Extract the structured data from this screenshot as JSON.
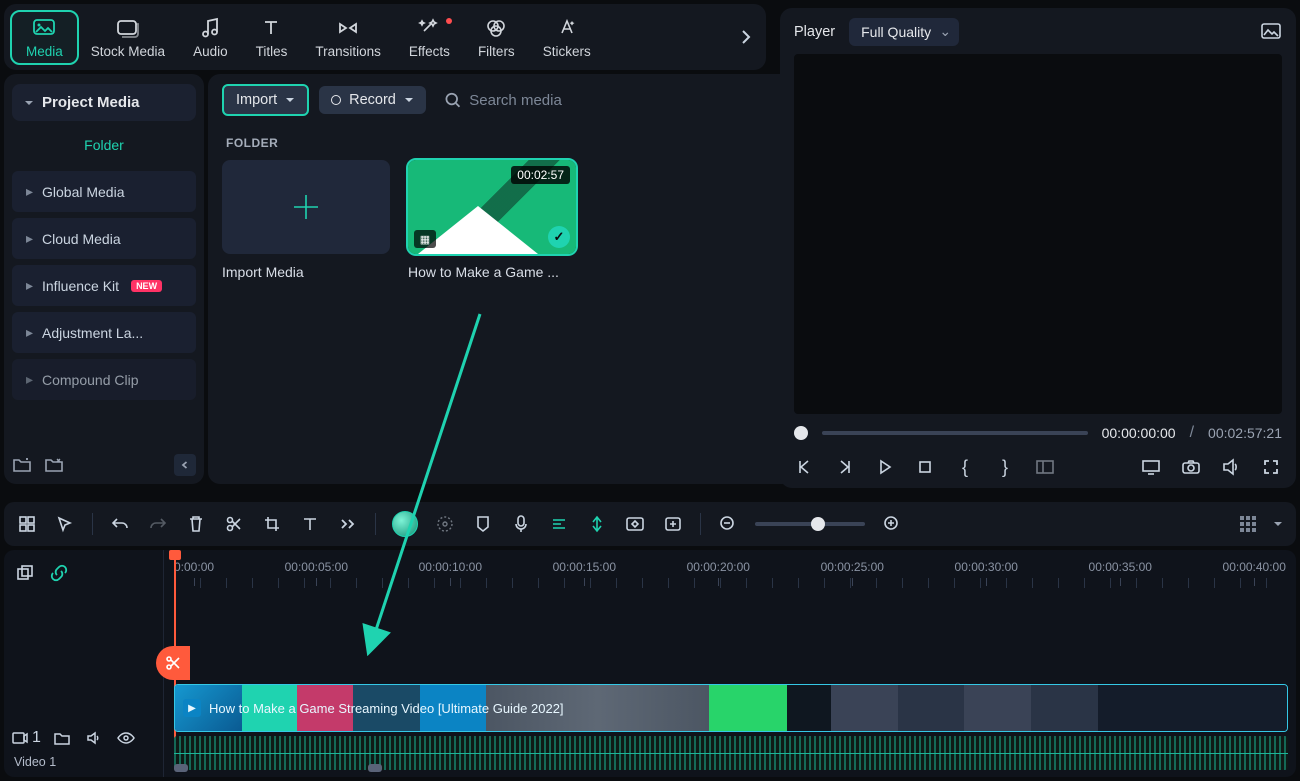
{
  "tabs": {
    "media": "Media",
    "stock": "Stock Media",
    "audio": "Audio",
    "titles": "Titles",
    "transitions": "Transitions",
    "effects": "Effects",
    "filters": "Filters",
    "stickers": "Stickers"
  },
  "sidebar": {
    "header": "Project Media",
    "folder_heading": "Folder",
    "global": "Global Media",
    "cloud": "Cloud Media",
    "influence": "Influence Kit",
    "adjustment": "Adjustment La...",
    "compound": "Compound Clip",
    "new_badge": "NEW"
  },
  "toolbar": {
    "import": "Import",
    "record": "Record",
    "search_placeholder": "Search media"
  },
  "folder_heading": "FOLDER",
  "import_card": "Import Media",
  "media_clip": {
    "label": "How to Make a Game ...",
    "duration": "00:02:57"
  },
  "player": {
    "label": "Player",
    "quality": "Full Quality",
    "time_current": "00:00:00:00",
    "time_total": "00:02:57:21",
    "separator": "/"
  },
  "ruler": {
    "t0": "0:00:00",
    "t1": "00:00:05:00",
    "t2": "00:00:10:00",
    "t3": "00:00:15:00",
    "t4": "00:00:20:00",
    "t5": "00:00:25:00",
    "t6": "00:00:30:00",
    "t7": "00:00:35:00",
    "t8": "00:00:40:00"
  },
  "track": {
    "badge": "1",
    "name": "Video 1",
    "clip_title": "How to Make a Game Streaming Video [Ultimate Guide 2022]"
  }
}
